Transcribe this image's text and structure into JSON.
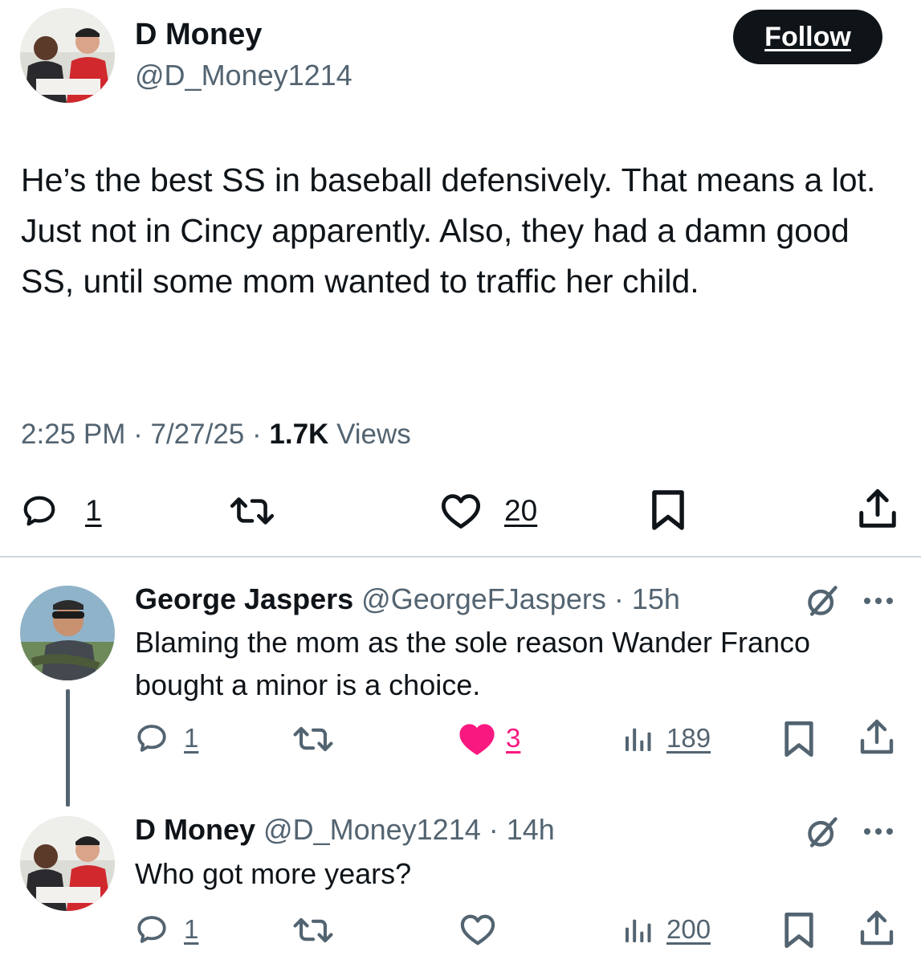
{
  "main_tweet": {
    "author_name": "D Money",
    "author_handle": "@D_Money1214",
    "follow_label": "Follow",
    "text": "He’s the best SS in baseball defensively. That means a lot. Just not in Cincy apparently. Also, they had a damn good SS, until some mom wanted to traffic her child.",
    "time": "2:25 PM",
    "date": "7/27/25",
    "views_count": "1.7K",
    "views_label": "Views",
    "separator": "·",
    "reply_count": "1",
    "like_count": "20"
  },
  "replies": [
    {
      "author_name": "George Jaspers",
      "author_handle": "@GeorgeFJaspers",
      "separator": "·",
      "age": "15h",
      "text": "Blaming the mom as the sole reason Wander Franco bought a minor is a choice.",
      "reply_count": "1",
      "like_count": "3",
      "liked": true,
      "views_count": "189"
    },
    {
      "author_name": "D Money",
      "author_handle": "@D_Money1214",
      "separator": "·",
      "age": "14h",
      "text": "Who got more years?",
      "reply_count": "1",
      "like_count": "",
      "liked": false,
      "views_count": "200"
    }
  ],
  "colors": {
    "text": "#0f1419",
    "muted": "#536471",
    "like_active": "#f91880",
    "divider": "#cfd9de",
    "thread_line": "#536471"
  },
  "icons": [
    "reply-icon",
    "retweet-icon",
    "like-icon",
    "bookmark-icon",
    "share-icon",
    "views-icon",
    "grok-icon",
    "more-icon"
  ]
}
